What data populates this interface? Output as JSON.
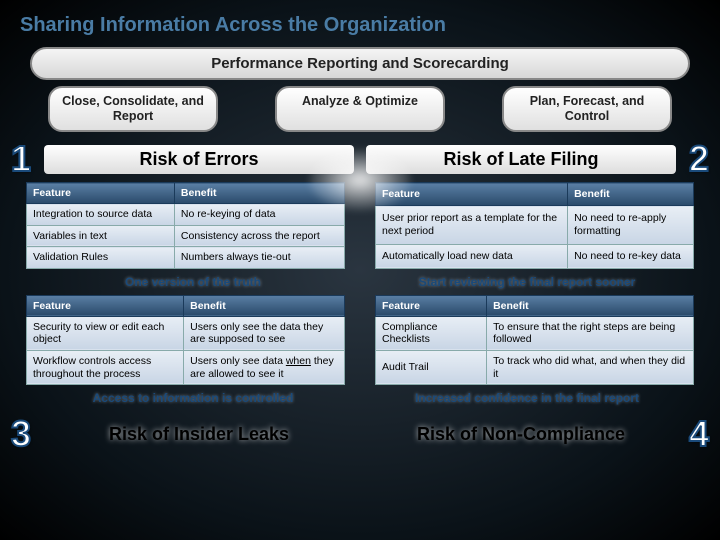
{
  "title": "Sharing Information Across the Organization",
  "banner": "Performance Reporting and Scorecarding",
  "pills": {
    "left": "Close, Consolidate, and Report",
    "center": "Analyze & Optimize",
    "right": "Plan, Forecast, and Control"
  },
  "risks": {
    "r1": {
      "num": "1",
      "title": "Risk of Errors"
    },
    "r2": {
      "num": "2",
      "title": "Risk of Late Filing"
    },
    "r3": {
      "num": "3",
      "title": "Risk of Insider Leaks"
    },
    "r4": {
      "num": "4",
      "title": "Risk of Non-Compliance"
    }
  },
  "table1": {
    "headers": {
      "feature": "Feature",
      "benefit": "Benefit"
    },
    "rows": [
      {
        "feature": "Integration to source data",
        "benefit": "No re-keying of data"
      },
      {
        "feature": "Variables in text",
        "benefit": "Consistency across the report"
      },
      {
        "feature": "Validation Rules",
        "benefit": "Numbers always tie-out"
      }
    ]
  },
  "table2": {
    "headers": {
      "feature": "Feature",
      "benefit": "Benefit"
    },
    "rows": [
      {
        "feature": "User prior report as a template for the next period",
        "benefit": "No need to re-apply formatting"
      },
      {
        "feature": "Automatically load new data",
        "benefit": "No need to re-key data"
      }
    ]
  },
  "table3": {
    "headers": {
      "feature": "Feature",
      "benefit": "Benefit"
    },
    "rows": [
      {
        "feature": "Security to view or edit each object",
        "benefit": "Users only see the data they are supposed to see"
      },
      {
        "feature": "Workflow controls access throughout the process",
        "benefit_pre": "Users only see data ",
        "benefit_u": "when",
        "benefit_post": " they are allowed to see it"
      }
    ]
  },
  "table4": {
    "headers": {
      "feature": "Feature",
      "benefit": "Benefit"
    },
    "rows": [
      {
        "feature": "Compliance Checklists",
        "benefit": "To ensure that the right steps are being followed"
      },
      {
        "feature": "Audit Trail",
        "benefit": "To track who did what, and when they did it"
      }
    ]
  },
  "taglines": {
    "t1": "One version of the truth",
    "t2": "Start reviewing the final report sooner",
    "t3": "Access to information is controlled",
    "t4": "Increased confidence in the final report"
  }
}
